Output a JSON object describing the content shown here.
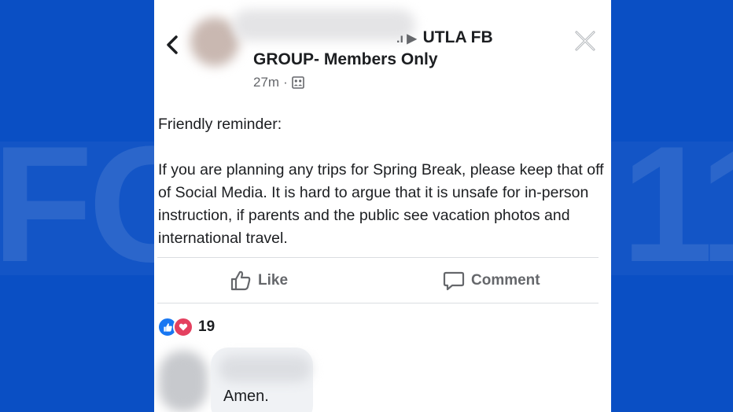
{
  "watermark": {
    "left_text": "FO",
    "right_text": "11"
  },
  "post": {
    "group_line1": "UTLA FB",
    "group_line1_prefix": ".ı ▶",
    "group_line2": "GROUP- Members Only",
    "time": "27m",
    "meta_separator": "·",
    "body": {
      "line1": "Friendly reminder:",
      "line2": "If you are planning any trips for Spring Break, please keep that off of Social Media.  It is hard to argue that it is unsafe for in-person instruction, if parents and the public see vacation photos and international travel."
    },
    "actions": {
      "like_label": "Like",
      "comment_label": "Comment"
    },
    "reactions": {
      "count": "19"
    }
  },
  "comment": {
    "text": "Amen."
  },
  "icons": {
    "back": "chevron-left-icon",
    "close": "close-icon",
    "audience": "group-audience-icon",
    "like": "thumbs-up-icon",
    "comment": "speech-bubble-icon"
  },
  "colors": {
    "background_blue": "#0a4fc4",
    "facebook_blue": "#1877f2",
    "love_red": "#e4405f",
    "text_primary": "#1c1e21",
    "text_secondary": "#65676b"
  }
}
